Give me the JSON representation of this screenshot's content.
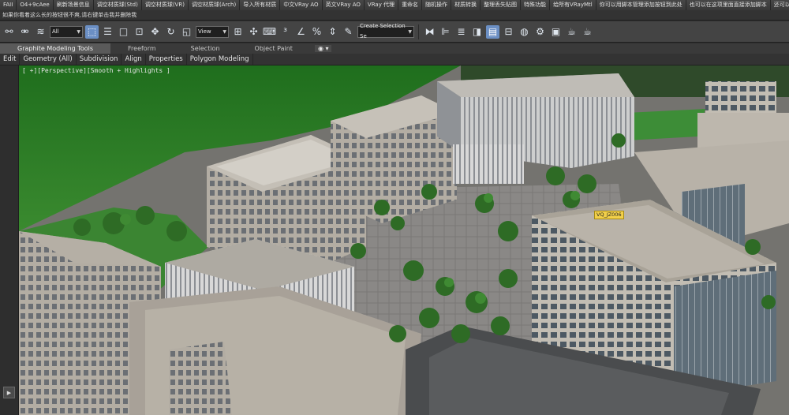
{
  "scriptbar": {
    "buttons": [
      "FAII",
      "O4+9cAee",
      "刷新场景信息",
      "调空材质球(Std)",
      "调空材质球(VR)",
      "调空材质球(Arch)",
      "导入所有材质",
      "中文VRay AO",
      "英文VRay AO",
      "VRay 代理",
      "重命名",
      "随机操作",
      "材质转换",
      "整理丢失贴图",
      "特殊功能",
      "给所有VRayMtl",
      "你可以用脚本管理添加按钮到此处",
      "也可以在这项里面直接添加脚本",
      "还可以添加exe文件"
    ]
  },
  "notebar": {
    "text": "如果你看着这么长的按钮很不爽,请右键单击我并删除我"
  },
  "toolbar": {
    "filter_select": "All",
    "view_select": "View",
    "selection_set_placeholder": "Create Selection Se"
  },
  "ribbon": {
    "tabs": [
      "Graphite Modeling Tools",
      "Freeform",
      "Selection",
      "Object Paint"
    ],
    "active_tab": 0,
    "menu_glyph": "◉ ▾",
    "subtabs": [
      "Edit",
      "Geometry (All)",
      "Subdivision",
      "Align",
      "Properties",
      "Polygon Modeling"
    ]
  },
  "viewport": {
    "label": "[ +][Perspective][Smooth + Highlights ]",
    "building_tag": "VQ_JZ006"
  },
  "colors": {
    "grass": "#2f7d2b",
    "roof": "#b9b3a8",
    "facade": "#a8a39a",
    "active_icon": "#6b8fc4",
    "tag": "#f2d04a"
  }
}
